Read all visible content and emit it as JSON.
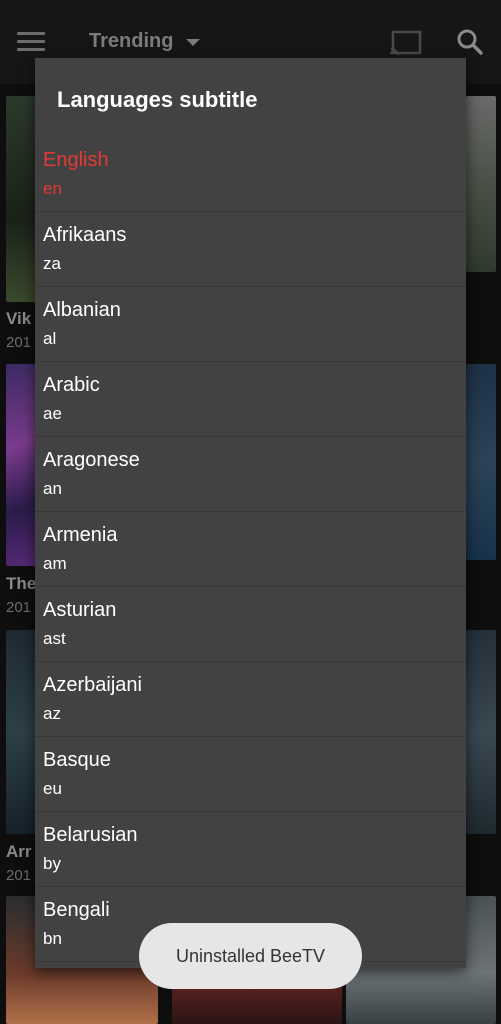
{
  "app": {
    "title": "Trending",
    "icons": [
      "menu-icon",
      "chevron-down-icon",
      "cast-icon",
      "search-icon"
    ]
  },
  "background": {
    "rows": [
      {
        "title": "Vik",
        "year": "201"
      },
      {
        "title": "The",
        "year": "201"
      },
      {
        "title": "Arr",
        "year": "201"
      }
    ]
  },
  "dialog": {
    "title": "Languages subtitle",
    "accent_color": "#e53935",
    "items": [
      {
        "name": "English",
        "code": "en",
        "selected": true
      },
      {
        "name": "Afrikaans",
        "code": "za"
      },
      {
        "name": "Albanian",
        "code": "al"
      },
      {
        "name": "Arabic",
        "code": "ae"
      },
      {
        "name": "Aragonese",
        "code": "an"
      },
      {
        "name": "Armenia",
        "code": "am"
      },
      {
        "name": "Asturian",
        "code": "ast"
      },
      {
        "name": "Azerbaijani",
        "code": "az"
      },
      {
        "name": "Basque",
        "code": "eu"
      },
      {
        "name": "Belarusian",
        "code": "by"
      },
      {
        "name": "Bengali",
        "code": "bn"
      }
    ]
  },
  "toast": {
    "text": "Uninstalled BeeTV"
  }
}
